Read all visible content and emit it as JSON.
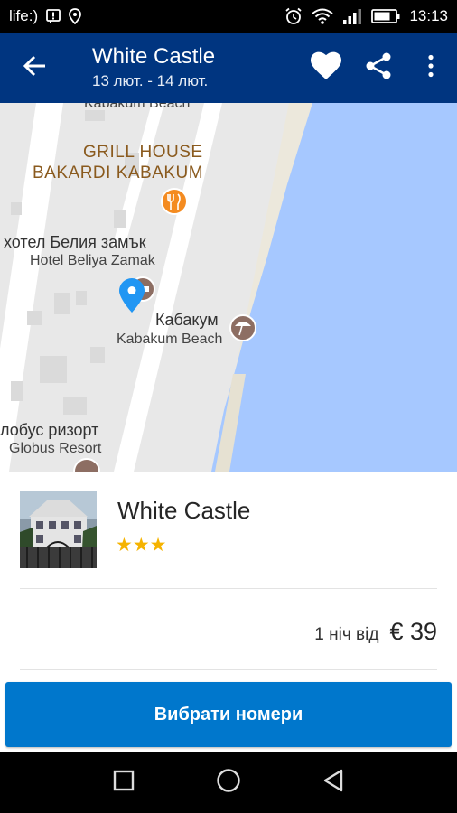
{
  "status_bar": {
    "carrier": "life:)",
    "time": "13:13",
    "icons": [
      "notification-icon",
      "location-icon",
      "alarm-icon",
      "wifi-icon",
      "signal-icon",
      "battery-icon"
    ]
  },
  "app_bar": {
    "title": "White Castle",
    "dates": "13 лют. - 14 лют.",
    "icons": [
      "back-arrow-icon",
      "heart-icon",
      "share-icon",
      "more-vert-icon"
    ],
    "background": "#003580"
  },
  "map": {
    "labels": {
      "top_cut": "Kabakum Beach",
      "grill_line1": "GRILL HOUSE",
      "grill_line2": "BAKARDI KABAKUM",
      "hotel_bg": "хотел Белия замък",
      "hotel_en": "Hotel Beliya Zamak",
      "beach_bg": "Кабакум",
      "beach_en": "Kabakum Beach",
      "globus_bg": "лобус ризорт",
      "globus_en": "Globus Resort"
    },
    "colors": {
      "water": "#a6c8ff",
      "land": "#e8e8e8",
      "road": "#ffffff",
      "pin": "#2196f3",
      "poi_food": "#f48b20",
      "poi_beach": "#8d6e63"
    }
  },
  "hotel": {
    "name": "White Castle",
    "stars": "★★★",
    "star_count": 3,
    "price_prefix": "1 ніч від",
    "price": "€ 39"
  },
  "cta": {
    "label": "Вибрати номери",
    "color": "#0077cc"
  },
  "nav_bar": {
    "icons": [
      "recent-apps-icon",
      "home-icon",
      "back-icon"
    ]
  }
}
